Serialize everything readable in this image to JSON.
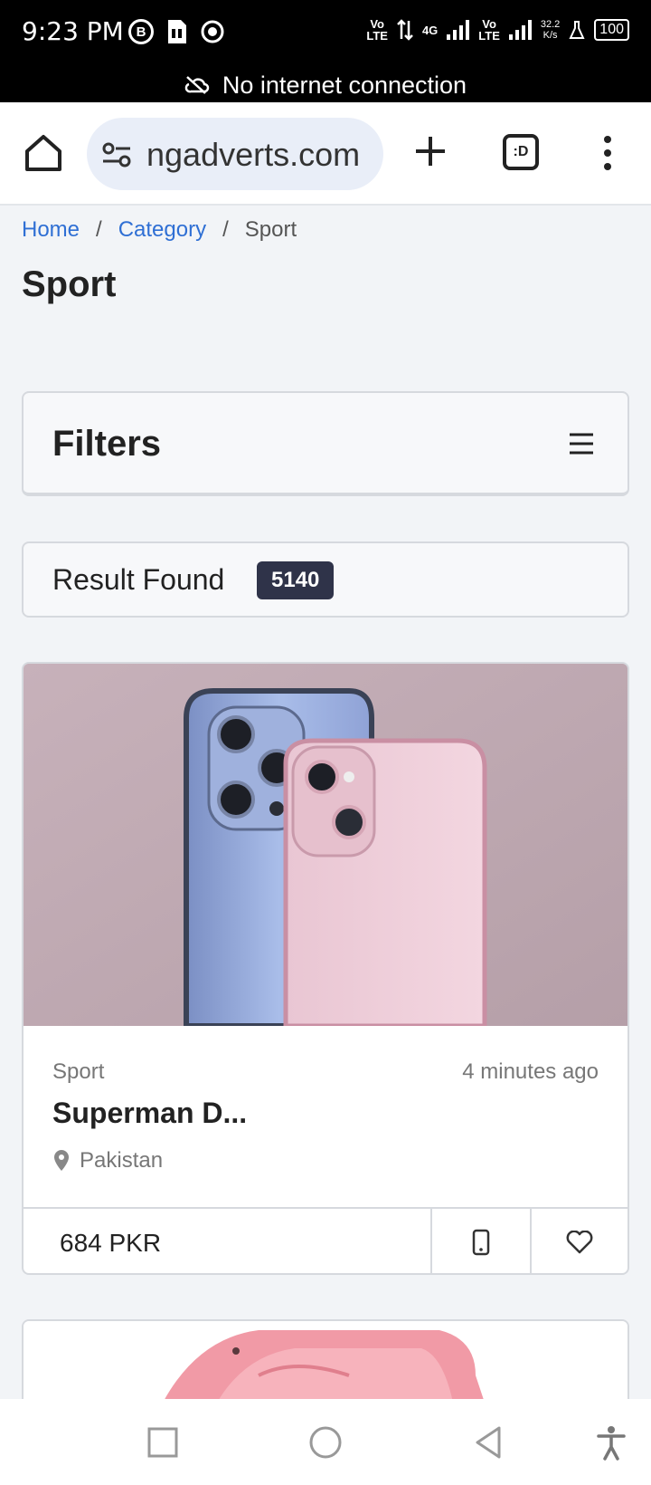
{
  "status_bar": {
    "time": "9:23 PM",
    "net1": "Vo\nLTE",
    "net2": "4G",
    "net3": "Vo\nLTE",
    "speed_value": "32.2",
    "speed_unit": "K/s",
    "battery": "100"
  },
  "offline_banner": {
    "text": "No internet connection"
  },
  "browser": {
    "url": "ngadverts.com",
    "tabs_label": ":D"
  },
  "breadcrumb": {
    "home": "Home",
    "category": "Category",
    "current": "Sport",
    "separator": "/"
  },
  "page": {
    "title": "Sport"
  },
  "filters": {
    "title": "Filters"
  },
  "results": {
    "label": "Result Found",
    "count": "5140"
  },
  "listing": {
    "category": "Sport",
    "time": "4 minutes ago",
    "title": "Superman D...",
    "location": "Pakistan",
    "price": "684 PKR"
  },
  "colors": {
    "link": "#2f6fd4",
    "badge_bg": "#2f3349",
    "page_bg": "#f2f4f7"
  },
  "icons": [
    "home-icon",
    "site-settings-icon",
    "plus-icon",
    "tab-switcher-icon",
    "more-menu-icon",
    "hamburger-icon",
    "location-pin-icon",
    "phone-icon",
    "heart-icon",
    "nav-recents-icon",
    "nav-home-icon",
    "nav-back-icon",
    "accessibility-icon"
  ]
}
